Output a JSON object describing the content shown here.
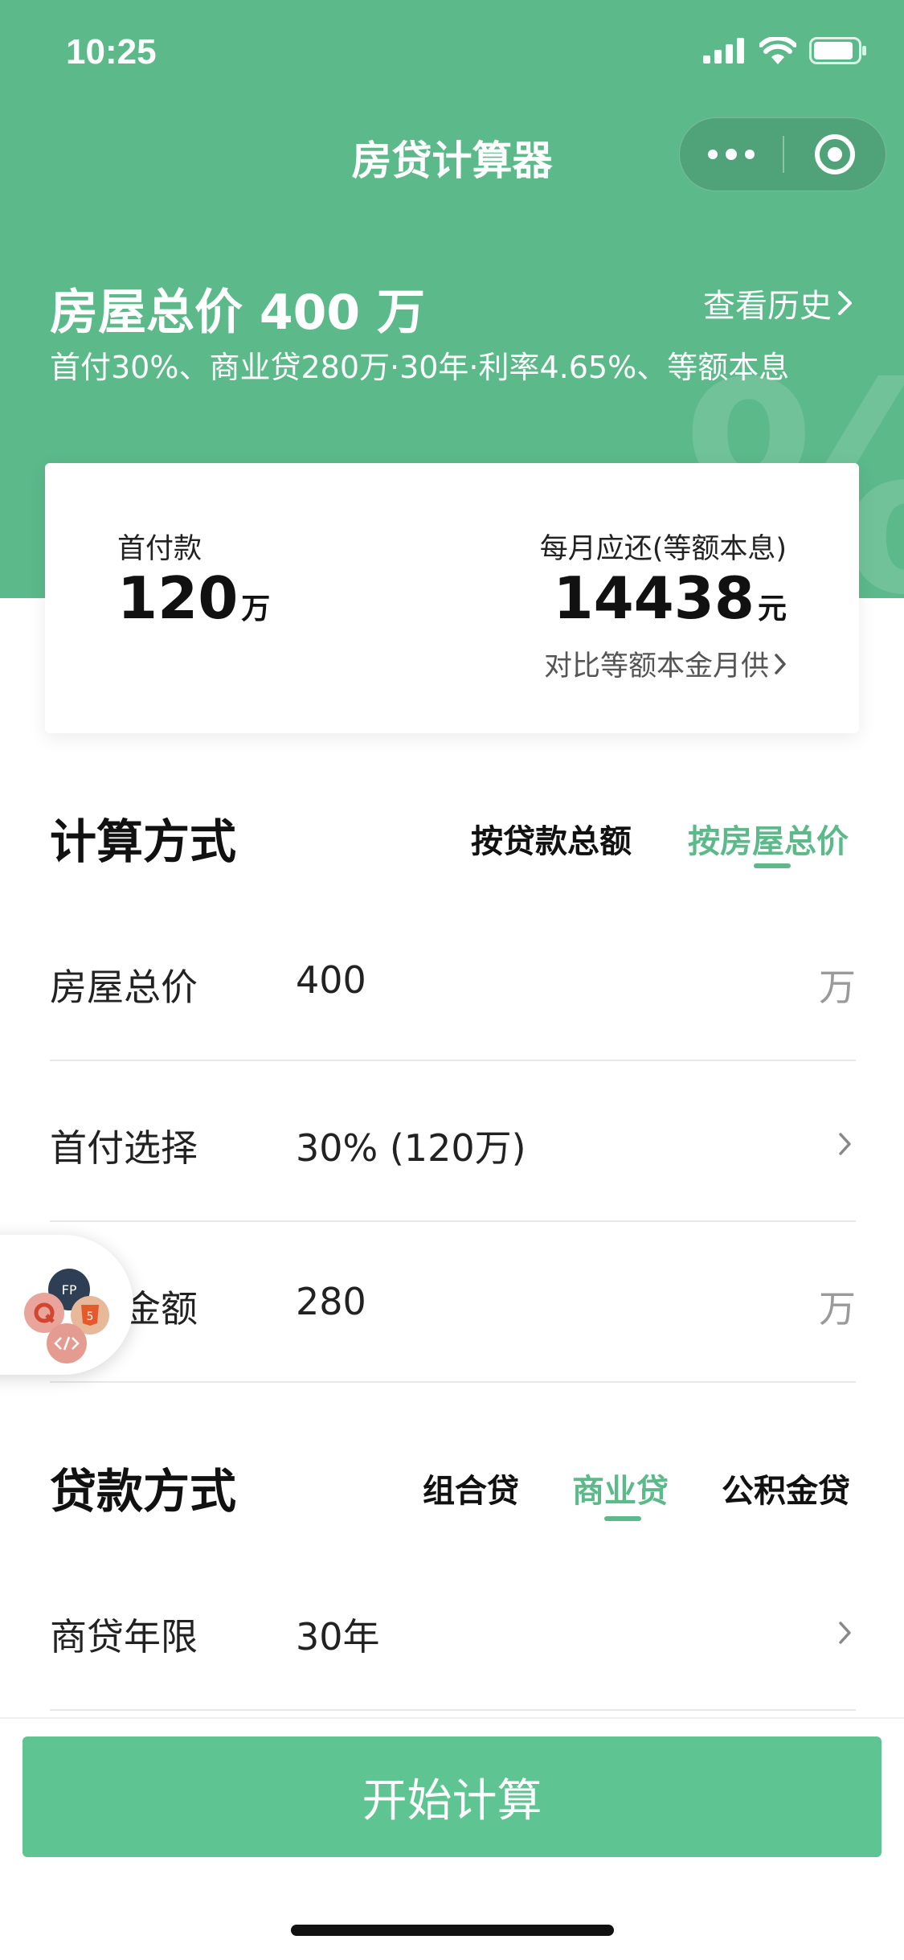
{
  "status_bar": {
    "time": "10:25"
  },
  "nav": {
    "title": "房贷计算器"
  },
  "colors": {
    "brand": "#5cb98a",
    "cta": "#5ec592",
    "muted": "#9a9a9a"
  },
  "header": {
    "house_title": "房屋总价 400 万",
    "history_link": "查看历史",
    "summary": "首付30%、商业贷280万·30年·利率4.65%、等额本息"
  },
  "result_card": {
    "down_payment_label": "首付款",
    "down_payment_value": "120",
    "down_payment_unit": "万",
    "monthly_label": "每月应还(等额本息)",
    "monthly_value": "14438",
    "monthly_unit": "元",
    "compare_link": "对比等额本金月供"
  },
  "calc_method": {
    "title": "计算方式",
    "options": [
      {
        "label": "按贷款总额",
        "active": false
      },
      {
        "label": "按房屋总价",
        "active": true
      }
    ]
  },
  "form": {
    "house_price": {
      "label": "房屋总价",
      "value": "400",
      "unit": "万"
    },
    "down_payment": {
      "label": "首付选择",
      "value": "30% (120万)"
    },
    "loan_amount": {
      "label": "贷款金额",
      "value": "280",
      "unit": "万"
    }
  },
  "loan_type": {
    "title": "贷款方式",
    "options": [
      {
        "label": "组合贷",
        "active": false
      },
      {
        "label": "商业贷",
        "active": true
      },
      {
        "label": "公积金贷",
        "active": false
      }
    ]
  },
  "loan_term": {
    "label": "商贷年限",
    "value": "30年"
  },
  "cta": {
    "label": "开始计算"
  },
  "floating_widget": {
    "icons": [
      "fp-avatar-icon",
      "q-logo-icon",
      "html5-icon",
      "code-icon"
    ]
  }
}
